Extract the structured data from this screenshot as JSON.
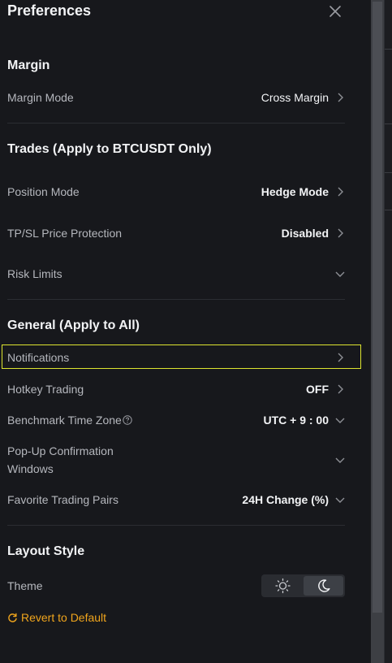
{
  "header": {
    "title": "Preferences"
  },
  "sections": {
    "margin": {
      "title": "Margin",
      "rows": [
        {
          "label": "Margin Mode",
          "value": "Cross Margin"
        }
      ]
    },
    "trades": {
      "title": "Trades (Apply to BTCUSDT Only)",
      "rows": [
        {
          "label": "Position Mode",
          "value": "Hedge Mode"
        },
        {
          "label": "TP/SL Price Protection",
          "value": "Disabled"
        },
        {
          "label": "Risk Limits",
          "value": ""
        }
      ]
    },
    "general": {
      "title": "General (Apply to All)",
      "rows": [
        {
          "label": "Notifications",
          "value": ""
        },
        {
          "label": "Hotkey Trading",
          "value": "OFF"
        },
        {
          "label": "Benchmark Time Zone",
          "value": "UTC + 9 : 00"
        },
        {
          "label_line1": "Pop-Up Confirmation",
          "label_line2": "Windows",
          "value": ""
        },
        {
          "label": "Favorite Trading Pairs",
          "value": "24H Change (%)"
        }
      ]
    },
    "layout": {
      "title": "Layout Style",
      "theme_label": "Theme",
      "theme_options": [
        "light-theme-sun-icon",
        "dark-theme-moon-icon"
      ],
      "theme_selected": "dark"
    }
  },
  "footer": {
    "revert_label": "Revert to Default"
  },
  "colors": {
    "background": "#17181c",
    "highlight_border": "#dde42f",
    "accent_orange": "#f0a51c"
  }
}
